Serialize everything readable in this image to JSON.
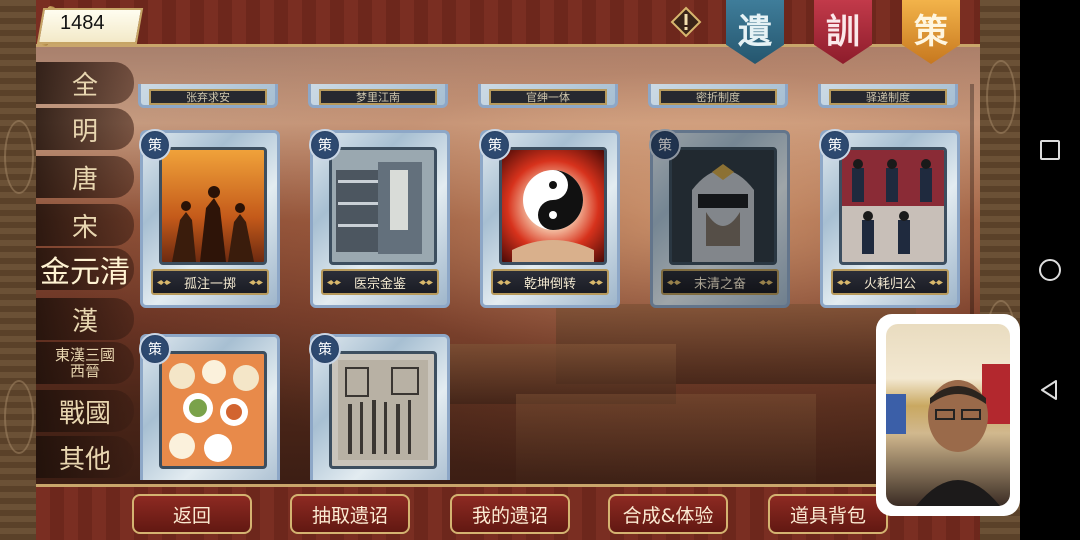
{
  "score": "1484",
  "banners": {
    "yi": "遺",
    "xun": "訓",
    "ce": "策"
  },
  "categories": [
    "全",
    "明",
    "唐",
    "宋",
    "金元清",
    "漢",
    "東漢三國\n西晉",
    "戰國",
    "其他"
  ],
  "active_category": "金元清",
  "top_row_labels": [
    "孤注一掷",
    "医宗金鉴",
    "乾坤倒转",
    "末清之奋",
    "火耗归公"
  ],
  "partial_row_labels": [
    "张弃求安",
    "梦里江南",
    "官绅一体",
    "密折制度",
    "驿递制度"
  ],
  "card_badge": "策",
  "bottom_buttons": [
    "返回",
    "抽取遗诏",
    "我的遗诏",
    "合成&体验",
    "道具背包"
  ],
  "colors": {
    "accent_gold": "#c9a66b",
    "button_red": "#8d2a22",
    "banner_blue": "#3f7d9a",
    "banner_red": "#c23a4a",
    "banner_orange": "#f2b34a"
  }
}
